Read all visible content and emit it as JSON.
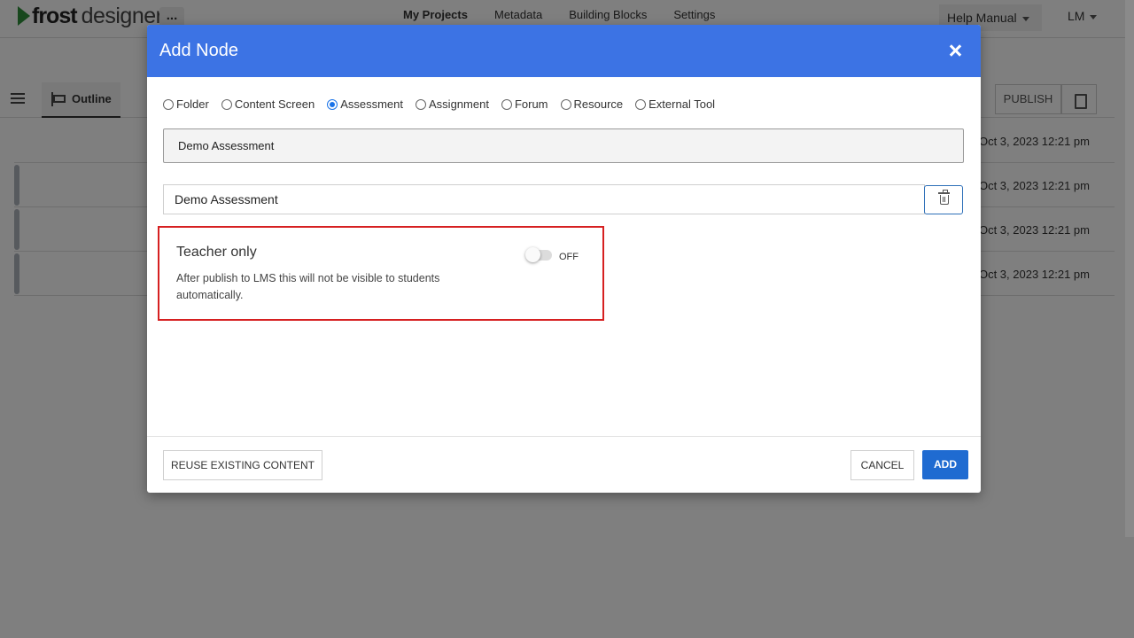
{
  "app": {
    "logo_bold": "frost",
    "logo_light": "designer",
    "more_label": "...",
    "nav": [
      "My Projects",
      "Metadata",
      "Building Blocks",
      "Settings"
    ],
    "help_label": "Help Manual",
    "user_label": "LM"
  },
  "toolbar": {
    "outline_label": "Outline",
    "publish_label": "PUBLISH"
  },
  "rows": [
    {
      "date": "Oct 3, 2023 12:21 pm"
    },
    {
      "date": "Oct 3, 2023 12:21 pm"
    },
    {
      "date": "Oct 3, 2023 12:21 pm"
    },
    {
      "date": "Oct 3, 2023 12:21 pm"
    }
  ],
  "modal": {
    "title": "Add Node",
    "node_types": [
      {
        "label": "Folder",
        "checked": false
      },
      {
        "label": "Content Screen",
        "checked": false
      },
      {
        "label": "Assessment",
        "checked": true
      },
      {
        "label": "Assignment",
        "checked": false
      },
      {
        "label": "Forum",
        "checked": false
      },
      {
        "label": "Resource",
        "checked": false
      },
      {
        "label": "External Tool",
        "checked": false
      }
    ],
    "field1_value": "Demo Assessment",
    "field2_value": "Demo Assessment",
    "teacher_only": {
      "title": "Teacher only",
      "description": "After publish to LMS this will not be visible to students automatically.",
      "toggle_state": "OFF"
    },
    "reuse_label": "REUSE EXISTING CONTENT",
    "cancel_label": "CANCEL",
    "add_label": "ADD"
  },
  "colors": {
    "header_blue": "#3c73e4",
    "add_button_blue": "#1f6bd1",
    "highlight_red": "#d62021"
  }
}
